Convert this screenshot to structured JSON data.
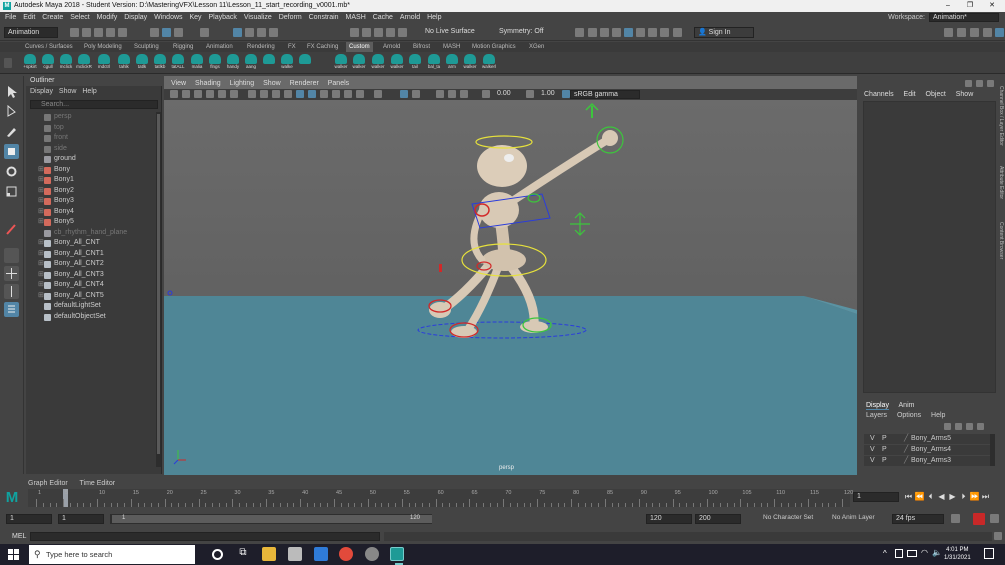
{
  "window": {
    "title": "Autodesk Maya 2018 - Student Version: D:\\MasteringVFX\\Lesson 11\\Lesson_11_start_recording_v0001.mb*",
    "logo": "M",
    "minimize": "–",
    "maximize": "❐",
    "close": "✕"
  },
  "menubar": {
    "items": [
      "File",
      "Edit",
      "Create",
      "Select",
      "Modify",
      "Display",
      "Windows",
      "Key",
      "Playback",
      "Visualize",
      "Deform",
      "Constrain",
      "MASH",
      "Cache",
      "Arnold",
      "Help"
    ],
    "workspace_label": "Workspace:",
    "workspace_value": "Animation*"
  },
  "statusline": {
    "mode": "Animation",
    "live_surface": "No Live Surface",
    "symmetry": "Symmetry: Off",
    "sign_in": "Sign In"
  },
  "shelf": {
    "tabs": [
      "Curves / Surfaces",
      "Poly Modeling",
      "Sculpting",
      "Rigging",
      "Animation",
      "Rendering",
      "FX",
      "FX Caching",
      "Custom",
      "Arnold",
      "Bifrost",
      "MASH",
      "Motion Graphics",
      "XGen"
    ],
    "active_tab": "Custom",
    "buttons": [
      "+spkirt",
      "cgull",
      "mclick",
      "mclickR",
      "mdctrl",
      "tahlk",
      "tatlk",
      "tatlkb",
      "tatALL",
      "malia",
      "flngs",
      "handy",
      "aang",
      "",
      "walke",
      "",
      "walker",
      "walker",
      "walker",
      "walker",
      "tail",
      "bal_ta",
      "arm",
      "walker",
      "walkerl"
    ]
  },
  "outliner": {
    "title": "Outliner",
    "menu": [
      "Display",
      "Show",
      "Help"
    ],
    "search_placeholder": "Search...",
    "items": [
      {
        "label": "persp",
        "dim": true,
        "expand": false,
        "icon": "camera-icon"
      },
      {
        "label": "top",
        "dim": true,
        "expand": false,
        "icon": "camera-icon"
      },
      {
        "label": "front",
        "dim": true,
        "expand": false,
        "icon": "camera-icon"
      },
      {
        "label": "side",
        "dim": true,
        "expand": false,
        "icon": "camera-icon"
      },
      {
        "label": "ground",
        "dim": false,
        "expand": false,
        "icon": "mesh-icon"
      },
      {
        "label": "Bony",
        "dim": false,
        "expand": true,
        "icon": "joint-icon"
      },
      {
        "label": "Bony1",
        "dim": false,
        "expand": true,
        "icon": "joint-icon"
      },
      {
        "label": "Bony2",
        "dim": false,
        "expand": true,
        "icon": "joint-icon"
      },
      {
        "label": "Bony3",
        "dim": false,
        "expand": true,
        "icon": "joint-icon"
      },
      {
        "label": "Bony4",
        "dim": false,
        "expand": true,
        "icon": "joint-icon"
      },
      {
        "label": "Bony5",
        "dim": false,
        "expand": true,
        "icon": "joint-icon"
      },
      {
        "label": "cb_rhythm_hand_plane",
        "dim": true,
        "expand": false,
        "icon": "mesh-icon"
      },
      {
        "label": "Bony_All_CNT",
        "dim": false,
        "expand": true,
        "icon": "control-icon"
      },
      {
        "label": "Bony_All_CNT1",
        "dim": false,
        "expand": true,
        "icon": "control-icon"
      },
      {
        "label": "Bony_All_CNT2",
        "dim": false,
        "expand": true,
        "icon": "control-icon"
      },
      {
        "label": "Bony_All_CNT3",
        "dim": false,
        "expand": true,
        "icon": "control-icon"
      },
      {
        "label": "Bony_All_CNT4",
        "dim": false,
        "expand": true,
        "icon": "control-icon"
      },
      {
        "label": "Bony_All_CNT5",
        "dim": false,
        "expand": true,
        "icon": "control-icon"
      },
      {
        "label": "defaultLightSet",
        "dim": false,
        "expand": false,
        "icon": "set-icon"
      },
      {
        "label": "defaultObjectSet",
        "dim": false,
        "expand": false,
        "icon": "set-icon"
      }
    ]
  },
  "viewport": {
    "menu": [
      "View",
      "Shading",
      "Lighting",
      "Show",
      "Renderer",
      "Panels"
    ],
    "exposure": "0.00",
    "gamma": "1.00",
    "color_space": "sRGB gamma",
    "camera_label": "persp"
  },
  "channel_box": {
    "tabs": [
      "Channels",
      "Edit",
      "Object",
      "Show"
    ],
    "side_tabs": [
      "Channel Box / Layer Editor",
      "Attribute Editor",
      "Content Browser"
    ]
  },
  "layer_editor": {
    "tabs": [
      "Display",
      "Anim"
    ],
    "active_tab": "Display",
    "menu": [
      "Layers",
      "Options",
      "Help"
    ],
    "layers": [
      {
        "v": "V",
        "p": "P",
        "name": "Bony_Arms5"
      },
      {
        "v": "V",
        "p": "P",
        "name": "Bony_Arms4"
      },
      {
        "v": "V",
        "p": "P",
        "name": "Bony_Arms3"
      }
    ]
  },
  "timeline": {
    "tabs": [
      "Graph Editor",
      "Time Editor"
    ],
    "ticks": [
      "1",
      "5",
      "10",
      "15",
      "20",
      "25",
      "30",
      "35",
      "40",
      "45",
      "50",
      "55",
      "60",
      "65",
      "70",
      "75",
      "80",
      "85",
      "90",
      "95",
      "100",
      "105",
      "110",
      "115",
      "120"
    ],
    "current_frame": "1"
  },
  "range": {
    "start": "1",
    "playback_start": "1",
    "slider_start": "1",
    "slider_end": "120",
    "playback_end": "120",
    "end": "200",
    "character_set": "No Character Set",
    "anim_layer": "No Anim Layer",
    "fps": "24 fps"
  },
  "command_line": {
    "label": "MEL"
  },
  "taskbar": {
    "search_placeholder": "Type here to search",
    "time": "4:01 PM",
    "date": "1/31/2021"
  },
  "colors": {
    "accent": "#5285a6",
    "maya_teal": "#1e9a96",
    "ground": "#4f8696",
    "character": "#d8c9b5",
    "control_yellow": "#e6e13c",
    "control_green": "#3cc63c",
    "control_red": "#d22828",
    "control_blue": "#2a3cdc"
  }
}
